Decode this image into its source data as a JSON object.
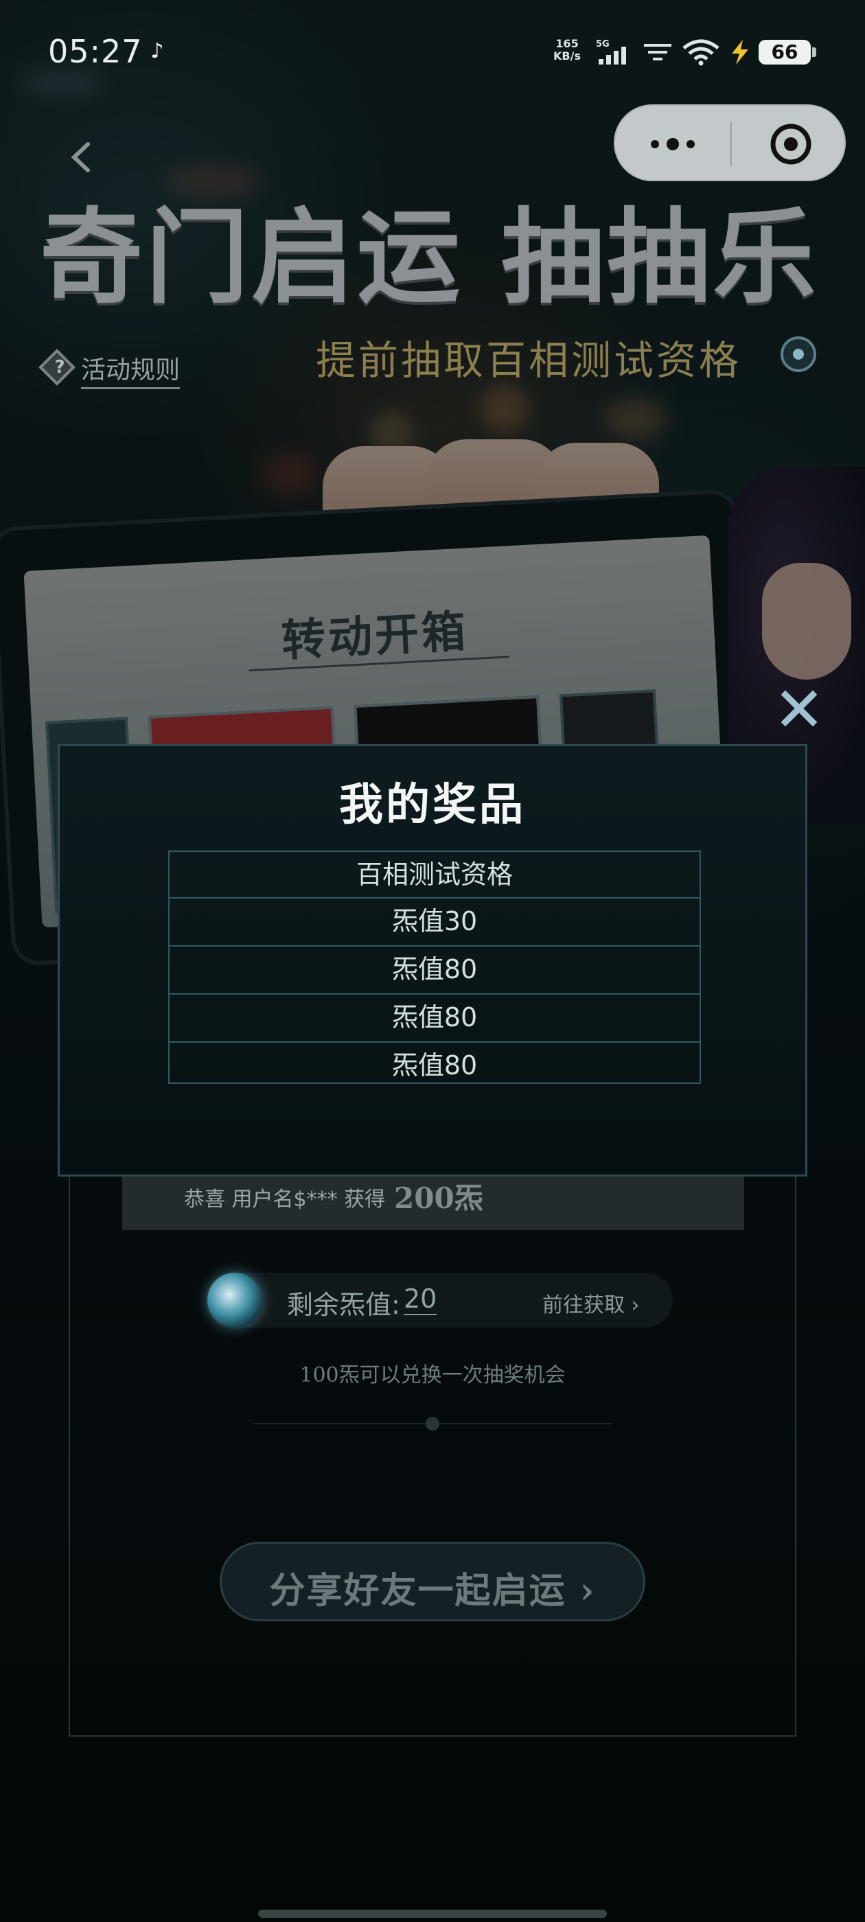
{
  "status_bar": {
    "time": "05:27",
    "network_speed": "165",
    "network_unit": "KB/s",
    "network_type": "5G",
    "battery": "66"
  },
  "page": {
    "title": "奇门启运 抽抽乐",
    "subtitle": "提前抽取百相测试资格",
    "rules_label": "活动规则",
    "phone_title": "转动开箱",
    "winner": {
      "text": "恭喜 用户名$*** 获得",
      "amount": "200炁"
    },
    "balance": {
      "label": "剩余炁值:",
      "value": "20",
      "go_label": "前往获取 ›"
    },
    "exchange_note": "100炁可以兑换一次抽奖机会",
    "share_label": "分享好友一起启运 ›"
  },
  "modal": {
    "title": "我的奖品",
    "prizes": [
      "百相测试资格",
      "炁值30",
      "炁值80",
      "炁值80",
      "炁值80"
    ]
  },
  "colors": {
    "modal_border": "#2e4a50",
    "table_border": "#2f5a60",
    "close_icon": "#9fc4d0"
  }
}
